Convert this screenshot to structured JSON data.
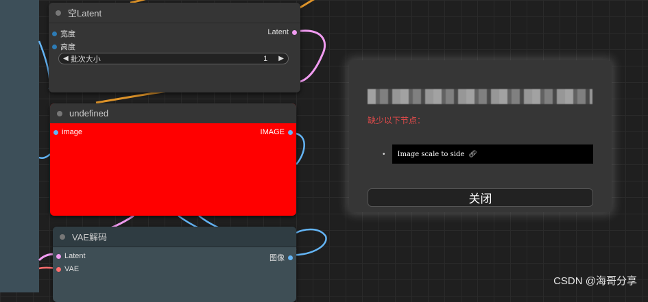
{
  "node_empty_latent": {
    "title": "空Latent",
    "inputs": [
      {
        "label": "宽度"
      },
      {
        "label": "高度"
      }
    ],
    "output": {
      "label": "Latent"
    },
    "widget": {
      "label": "批次大小",
      "value": "1"
    }
  },
  "node_undefined": {
    "title": "undefined",
    "input": {
      "label": "image"
    },
    "output": {
      "label": "IMAGE"
    }
  },
  "node_vae_decode": {
    "title": "VAE解码",
    "inputs": [
      {
        "label": "Latent"
      },
      {
        "label": "VAE"
      }
    ],
    "output": {
      "label": "图像"
    }
  },
  "dialog": {
    "missing_title": "缺少以下节点：",
    "missing_nodes": [
      "Image scale to side"
    ],
    "close_label": "关闭"
  },
  "watermark": "CSDN @海哥分享",
  "colors": {
    "latent": "#f09bf0",
    "int": "#2d7bb5",
    "image": "#64b5f6",
    "vae": "#ff6e6e",
    "undefined_bg": "#ff0000"
  }
}
